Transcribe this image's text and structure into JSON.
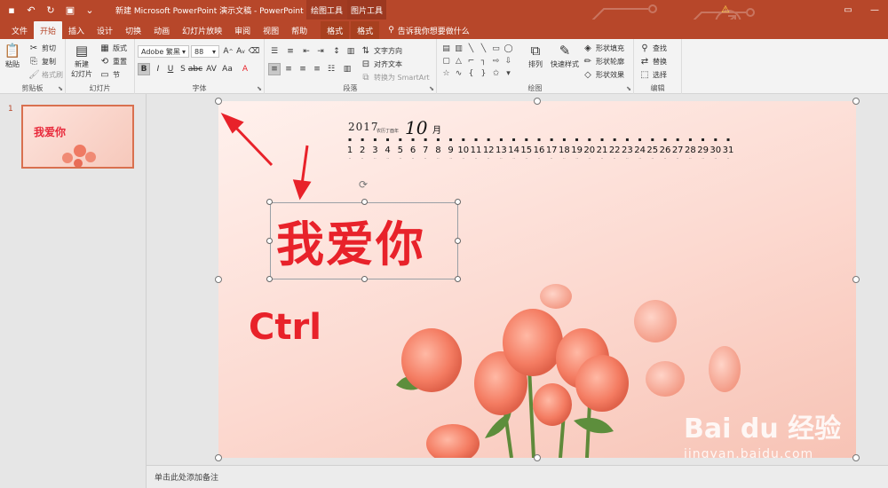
{
  "titlebar": {
    "doc_title": "新建 Microsoft PowerPoint 演示文稿 - PowerPoint",
    "context_tab_drawing": "绘图工具",
    "context_tab_picture": "图片工具"
  },
  "tabs": [
    {
      "label": "文件"
    },
    {
      "label": "开始"
    },
    {
      "label": "插入"
    },
    {
      "label": "设计"
    },
    {
      "label": "切换"
    },
    {
      "label": "动画"
    },
    {
      "label": "幻灯片放映"
    },
    {
      "label": "审阅"
    },
    {
      "label": "视图"
    },
    {
      "label": "帮助"
    },
    {
      "label": "格式"
    },
    {
      "label": "格式"
    }
  ],
  "tell_me": "告诉我你想要做什么",
  "ribbon": {
    "clipboard": {
      "label": "剪贴板",
      "paste": "粘贴",
      "cut": "剪切",
      "copy": "复制",
      "format_painter": "格式刷"
    },
    "slides": {
      "label": "幻灯片",
      "new_slide": "新建",
      "new_slide2": "幻灯片",
      "layout": "版式",
      "reset": "重置",
      "section": "节"
    },
    "font": {
      "label": "字体",
      "font_name": "Adobe 繁黑",
      "font_size": "88"
    },
    "paragraph": {
      "label": "段落",
      "text_direction": "文字方向",
      "align_text": "对齐文本",
      "smartart": "转换为 SmartArt"
    },
    "drawing": {
      "label": "绘图",
      "arrange": "排列",
      "quick_styles": "快速样式",
      "fill": "形状填充",
      "outline": "形状轮廓",
      "effects": "形状效果"
    },
    "editing": {
      "label": "编辑",
      "find": "查找",
      "replace": "替换",
      "select": "选择"
    }
  },
  "thumbnail": {
    "number": "1",
    "title": "我爱你"
  },
  "slide": {
    "calendar": {
      "year": "2017",
      "small_text": "农历丁酉年",
      "month": "10",
      "month_suffix": "月",
      "days": [
        "1",
        "2",
        "3",
        "4",
        "5",
        "6",
        "7",
        "8",
        "9",
        "10",
        "11",
        "12",
        "13",
        "14",
        "15",
        "16",
        "17",
        "18",
        "19",
        "20",
        "21",
        "22",
        "23",
        "24",
        "25",
        "26",
        "27",
        "28",
        "29",
        "30",
        "31"
      ]
    },
    "title_text": "我爱你",
    "ctrl_text": "Ctrl"
  },
  "notes_placeholder": "单击此处添加备注",
  "watermark": {
    "logo": "Bai du 经验",
    "url": "jingyan.baidu.com"
  },
  "colors": {
    "accent": "#b7472a",
    "red_text": "#e8222a",
    "arrow": "#e8222a"
  }
}
